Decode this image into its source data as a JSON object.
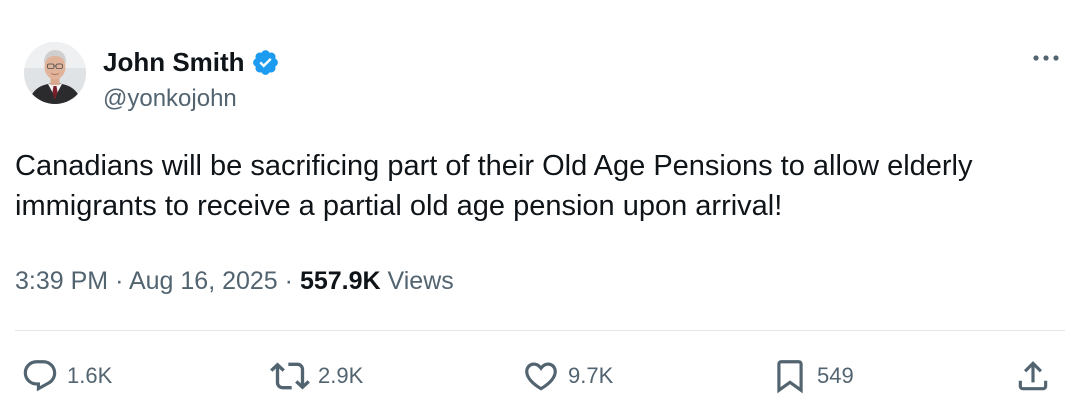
{
  "tweet": {
    "author": {
      "display_name": "John Smith",
      "handle": "@yonkojohn",
      "verified": true,
      "verified_icon": "verified-badge-icon",
      "verified_color": "#1d9bf0"
    },
    "text": "Canadians will be sacrificing part of their Old Age Pensions to allow elderly immigrants to receive a partial old age pension upon arrival!",
    "time": "3:39 PM",
    "separator": "·",
    "date": "Aug 16, 2025",
    "views_count": "557.9K",
    "views_label": "Views"
  },
  "actions": {
    "reply": {
      "icon": "reply-icon",
      "count": "1.6K"
    },
    "repost": {
      "icon": "repost-icon",
      "count": "2.9K"
    },
    "like": {
      "icon": "heart-icon",
      "count": "9.7K"
    },
    "bookmark": {
      "icon": "bookmark-icon",
      "count": "549"
    },
    "share": {
      "icon": "share-icon"
    }
  },
  "more_menu": {
    "icon": "more-icon"
  },
  "colors": {
    "text_primary": "#0f1419",
    "text_secondary": "#536471",
    "divider": "#e1e6ea"
  }
}
